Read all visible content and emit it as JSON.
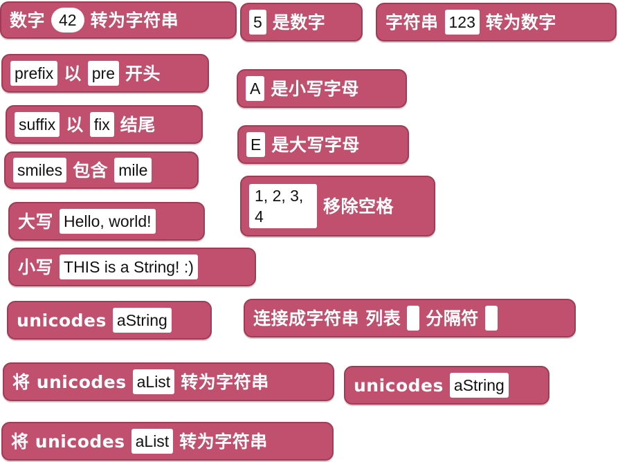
{
  "colors": {
    "block_fill": "#c0506d",
    "block_border": "#9f3b55",
    "label_text": "#ffffff",
    "slot_fill": "#ffffff",
    "slot_text": "#111111"
  },
  "blocks": {
    "num_to_string": {
      "label_a": "数字",
      "value": "42",
      "label_b": "转为字符串"
    },
    "is_number": {
      "value": "5",
      "label": "是数字"
    },
    "string_to_number": {
      "label_a": "字符串",
      "value": "123",
      "label_b": "转为数字"
    },
    "starts_with": {
      "value_a": "prefix",
      "label_a": "以",
      "value_b": "pre",
      "label_b": "开头"
    },
    "is_lowercase": {
      "value": "A",
      "label": "是小写字母"
    },
    "ends_with": {
      "value_a": "suffix",
      "label_a": "以",
      "value_b": "fix",
      "label_b": "结尾"
    },
    "is_uppercase": {
      "value": "E",
      "label": "是大写字母"
    },
    "contains": {
      "value_a": "smiles",
      "label": "包含",
      "value_b": "mile"
    },
    "remove_spaces": {
      "value": "1, 2, 3, 4",
      "label": "移除空格"
    },
    "to_uppercase": {
      "label": "大写",
      "value": "Hello, world!"
    },
    "to_lowercase": {
      "label": "小写",
      "value": "THIS is a String! :)"
    },
    "unicodes_1": {
      "label": "unicodes",
      "value": "aString"
    },
    "join_list": {
      "label_a": "连接成字符串 列表",
      "value_a": "",
      "label_b": "分隔符",
      "value_b": ""
    },
    "unicodes_to_string_1": {
      "label_a": "将 unicodes",
      "value": "aList",
      "label_b": "转为字符串"
    },
    "unicodes_2": {
      "label": "unicodes",
      "value": "aString"
    },
    "unicodes_to_string_2": {
      "label_a": "将 unicodes",
      "value": "aList",
      "label_b": "转为字符串"
    }
  }
}
